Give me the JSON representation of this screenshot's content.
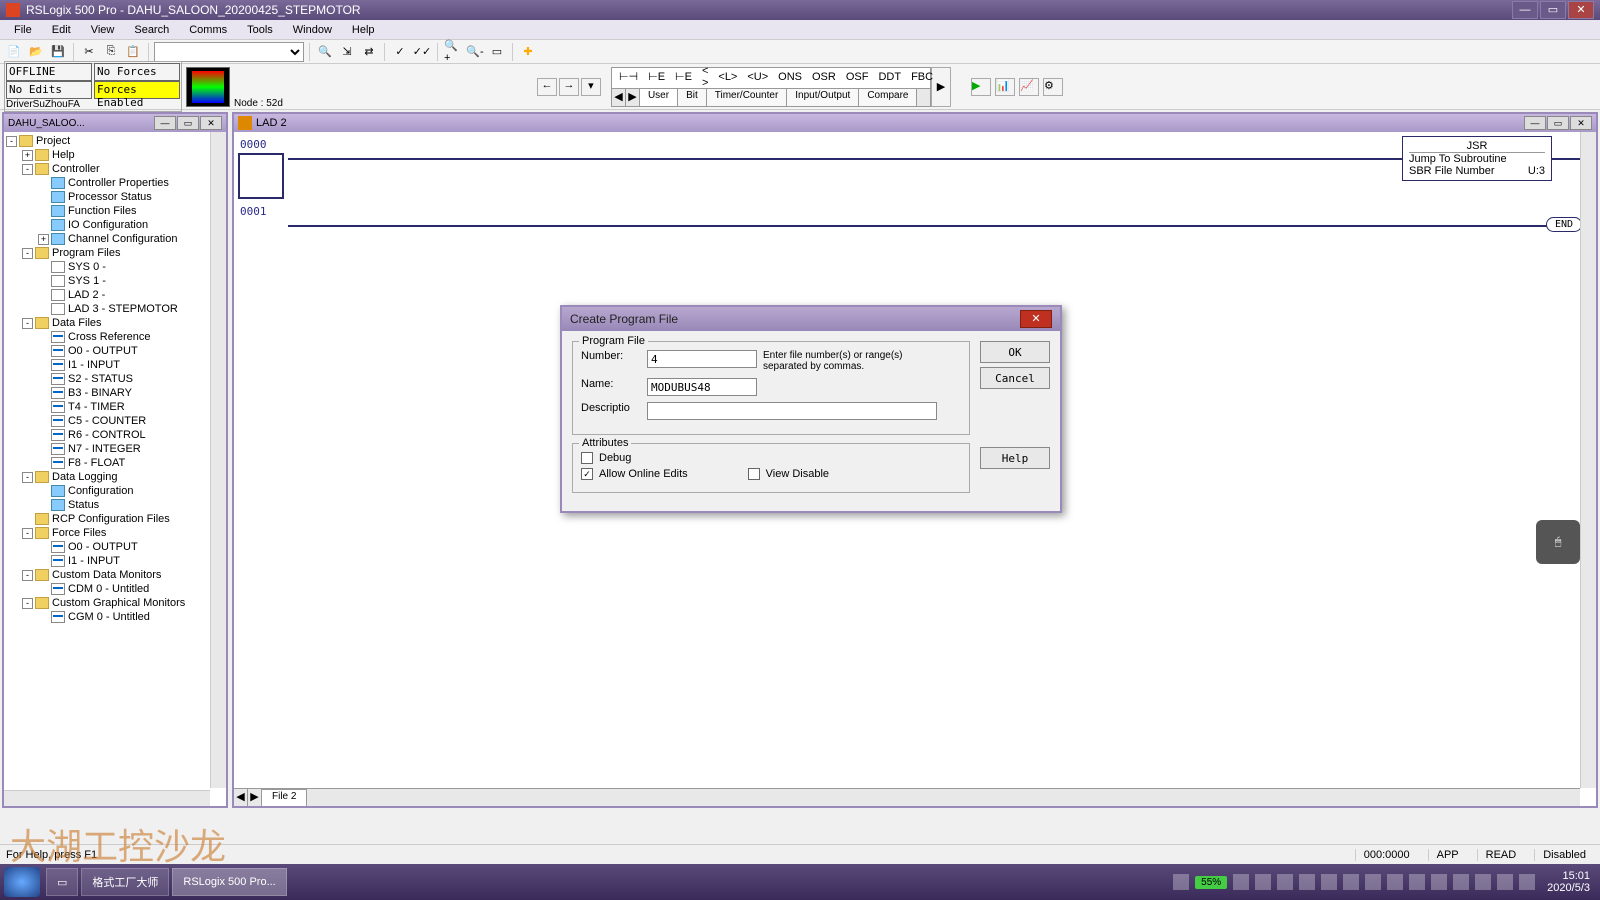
{
  "titlebar": {
    "text": "RSLogix 500 Pro - DAHU_SALOON_20200425_STEPMOTOR"
  },
  "menubar": [
    "File",
    "Edit",
    "View",
    "Search",
    "Comms",
    "Tools",
    "Window",
    "Help"
  ],
  "status": {
    "offline": "OFFLINE",
    "noforces": "No Forces",
    "noedits": "No Edits",
    "forces_enabled": "Forces Enabled",
    "driver": "DriverSuZhouFA",
    "node": "Node : 52d"
  },
  "instr_glyphs": [
    "⊢⊣",
    "⊢E",
    "⊢E",
    "< >",
    "<L>",
    "<U>",
    "ONS",
    "OSR",
    "OSF",
    "DDT",
    "FBC"
  ],
  "instr_tabs": [
    "User",
    "Bit",
    "Timer/Counter",
    "Input/Output",
    "Compare"
  ],
  "tree": {
    "panel_title": "DAHU_SALOO...",
    "root": "Project",
    "nodes": [
      {
        "indent": 0,
        "toggle": "-",
        "icon": "folder",
        "label": "Project"
      },
      {
        "indent": 1,
        "toggle": "+",
        "icon": "folder",
        "label": "Help"
      },
      {
        "indent": 1,
        "toggle": "-",
        "icon": "folder",
        "label": "Controller"
      },
      {
        "indent": 2,
        "toggle": "",
        "icon": "prop",
        "label": "Controller Properties"
      },
      {
        "indent": 2,
        "toggle": "",
        "icon": "prop",
        "label": "Processor Status"
      },
      {
        "indent": 2,
        "toggle": "",
        "icon": "prop",
        "label": "Function Files"
      },
      {
        "indent": 2,
        "toggle": "",
        "icon": "prop",
        "label": "IO Configuration"
      },
      {
        "indent": 2,
        "toggle": "+",
        "icon": "prop",
        "label": "Channel Configuration"
      },
      {
        "indent": 1,
        "toggle": "-",
        "icon": "folder",
        "label": "Program Files"
      },
      {
        "indent": 2,
        "toggle": "",
        "icon": "file",
        "label": "SYS 0 -"
      },
      {
        "indent": 2,
        "toggle": "",
        "icon": "file",
        "label": "SYS 1 -"
      },
      {
        "indent": 2,
        "toggle": "",
        "icon": "file",
        "label": "LAD 2 -"
      },
      {
        "indent": 2,
        "toggle": "",
        "icon": "file",
        "label": "LAD 3 - STEPMOTOR"
      },
      {
        "indent": 1,
        "toggle": "-",
        "icon": "folder",
        "label": "Data Files"
      },
      {
        "indent": 2,
        "toggle": "",
        "icon": "data",
        "label": "Cross Reference"
      },
      {
        "indent": 2,
        "toggle": "",
        "icon": "data",
        "label": "O0 - OUTPUT"
      },
      {
        "indent": 2,
        "toggle": "",
        "icon": "data",
        "label": "I1 - INPUT"
      },
      {
        "indent": 2,
        "toggle": "",
        "icon": "data",
        "label": "S2 - STATUS"
      },
      {
        "indent": 2,
        "toggle": "",
        "icon": "data",
        "label": "B3 - BINARY"
      },
      {
        "indent": 2,
        "toggle": "",
        "icon": "data",
        "label": "T4 - TIMER"
      },
      {
        "indent": 2,
        "toggle": "",
        "icon": "data",
        "label": "C5 - COUNTER"
      },
      {
        "indent": 2,
        "toggle": "",
        "icon": "data",
        "label": "R6 - CONTROL"
      },
      {
        "indent": 2,
        "toggle": "",
        "icon": "data",
        "label": "N7 - INTEGER"
      },
      {
        "indent": 2,
        "toggle": "",
        "icon": "data",
        "label": "F8 - FLOAT"
      },
      {
        "indent": 1,
        "toggle": "-",
        "icon": "folder",
        "label": "Data Logging"
      },
      {
        "indent": 2,
        "toggle": "",
        "icon": "prop",
        "label": "Configuration"
      },
      {
        "indent": 2,
        "toggle": "",
        "icon": "prop",
        "label": "Status"
      },
      {
        "indent": 1,
        "toggle": "",
        "icon": "folder",
        "label": "RCP Configuration Files"
      },
      {
        "indent": 1,
        "toggle": "-",
        "icon": "folder",
        "label": "Force Files"
      },
      {
        "indent": 2,
        "toggle": "",
        "icon": "data",
        "label": "O0 - OUTPUT"
      },
      {
        "indent": 2,
        "toggle": "",
        "icon": "data",
        "label": "I1 - INPUT"
      },
      {
        "indent": 1,
        "toggle": "-",
        "icon": "folder",
        "label": "Custom Data Monitors"
      },
      {
        "indent": 2,
        "toggle": "",
        "icon": "data",
        "label": "CDM 0 - Untitled"
      },
      {
        "indent": 1,
        "toggle": "-",
        "icon": "folder",
        "label": "Custom Graphical Monitors"
      },
      {
        "indent": 2,
        "toggle": "",
        "icon": "data",
        "label": "CGM 0 - Untitled"
      }
    ]
  },
  "ladder": {
    "title": "LAD 2",
    "rungs": [
      {
        "num": "0000",
        "jsr": {
          "title": "JSR",
          "line1": "Jump To Subroutine",
          "line2_l": "SBR File Number",
          "line2_r": "U:3"
        }
      },
      {
        "num": "0001",
        "end": "END"
      }
    ],
    "file_tab": "File 2"
  },
  "dialog": {
    "title": "Create Program File",
    "group1": "Program File",
    "number_label": "Number:",
    "number_value": "4",
    "number_hint": "Enter file number(s) or range(s) separated by commas.",
    "name_label": "Name:",
    "name_value": "MODUBUS48",
    "desc_label": "Descriptio",
    "desc_value": "",
    "group2": "Attributes",
    "debug": "Debug",
    "allow_edits": "Allow Online Edits",
    "view_disable": "View Disable",
    "ok": "OK",
    "cancel": "Cancel",
    "help": "Help"
  },
  "statusbar": {
    "help": "For Help, press F1",
    "addr": "000:0000",
    "app": "APP",
    "read": "READ",
    "disabled": "Disabled"
  },
  "taskbar": {
    "items": [
      "",
      "格式工厂大师",
      "RSLogix 500 Pro..."
    ],
    "battery": "55%",
    "time": "15:01",
    "date": "2020/5/3"
  },
  "watermark": "大湖工控沙龙"
}
